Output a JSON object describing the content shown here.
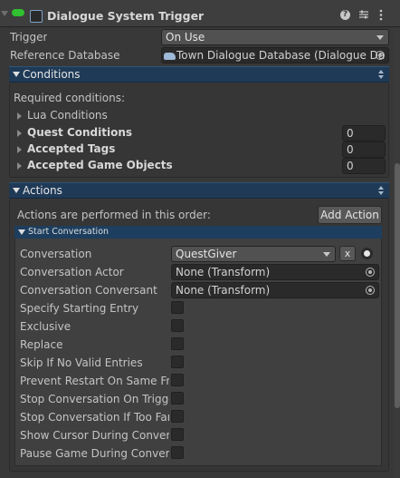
{
  "component": {
    "title": "Dialogue System Trigger",
    "icons": [
      "help-icon",
      "preset-icon",
      "kebab-menu-icon"
    ]
  },
  "trigger": {
    "label": "Trigger",
    "value": "On Use"
  },
  "reference_database": {
    "label": "Reference Database",
    "value": "Town Dialogue Database (Dialogue Da"
  },
  "conditions": {
    "header": "Conditions",
    "required_label": "Required conditions:",
    "items": [
      {
        "label": "Lua Conditions"
      },
      {
        "label": "Quest Conditions",
        "value": "0"
      },
      {
        "label": "Accepted Tags",
        "value": "0"
      },
      {
        "label": "Accepted Game Objects",
        "value": "0"
      }
    ]
  },
  "actions": {
    "header": "Actions",
    "order_label": "Actions are performed in this order:",
    "add_action_label": "Add Action",
    "start_conversation": {
      "header": "Start Conversation",
      "conversation": {
        "label": "Conversation",
        "value": "QuestGiver",
        "clear_label": "x"
      },
      "conversation_actor": {
        "label": "Conversation Actor",
        "value": "None (Transform)"
      },
      "conversation_conversant": {
        "label": "Conversation Conversant",
        "value": "None (Transform)"
      },
      "toggles": [
        {
          "label": "Specify Starting Entry",
          "checked": false
        },
        {
          "label": "Exclusive",
          "checked": false
        },
        {
          "label": "Replace",
          "checked": false
        },
        {
          "label": "Skip If No Valid Entries",
          "checked": false
        },
        {
          "label": "Prevent Restart On Same Fran",
          "checked": false
        },
        {
          "label": "Stop Conversation On Trigger",
          "checked": false
        },
        {
          "label": "Stop Conversation If Too Far",
          "checked": false
        },
        {
          "label": "Show Cursor During Conversa",
          "checked": false
        },
        {
          "label": "Pause Game During Conversa",
          "checked": false
        }
      ]
    }
  },
  "colors": {
    "background": "#383838",
    "section_header": "#1f3a57",
    "field_background": "#2a2a2a"
  }
}
